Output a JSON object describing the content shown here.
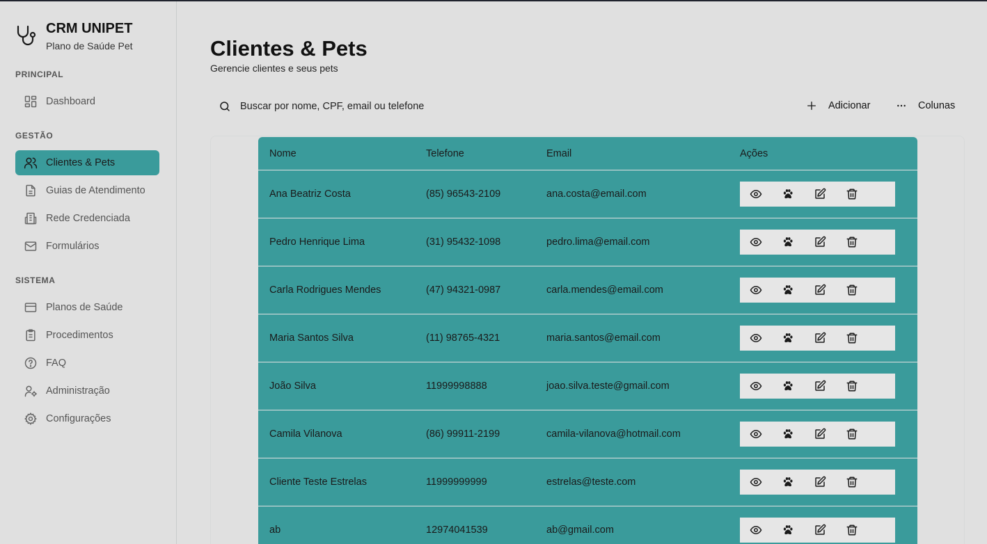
{
  "brand": {
    "title": "CRM UNIPET",
    "subtitle": "Plano de Saúde Pet"
  },
  "sidebar": {
    "sections": [
      {
        "label": "PRINCIPAL",
        "items": [
          {
            "label": "Dashboard",
            "icon": "dashboard-icon"
          }
        ]
      },
      {
        "label": "GESTÃO",
        "items": [
          {
            "label": "Clientes & Pets",
            "icon": "users-icon",
            "active": true
          },
          {
            "label": "Guias de Atendimento",
            "icon": "document-icon"
          },
          {
            "label": "Rede Credenciada",
            "icon": "building-icon"
          },
          {
            "label": "Formulários",
            "icon": "mail-icon"
          }
        ]
      },
      {
        "label": "SISTEMA",
        "items": [
          {
            "label": "Planos de Saúde",
            "icon": "credit-card-icon"
          },
          {
            "label": "Procedimentos",
            "icon": "clipboard-icon"
          },
          {
            "label": "FAQ",
            "icon": "help-circle-icon"
          },
          {
            "label": "Administração",
            "icon": "user-cog-icon"
          },
          {
            "label": "Configurações",
            "icon": "gear-icon"
          }
        ]
      }
    ]
  },
  "header": {
    "title": "Clientes & Pets",
    "subtitle": "Gerencie clientes e seus pets"
  },
  "toolbar": {
    "search_placeholder": "Buscar por nome, CPF, email ou telefone",
    "add_label": "Adicionar",
    "columns_label": "Colunas"
  },
  "table": {
    "columns": [
      "Nome",
      "Telefone",
      "Email",
      "Ações"
    ],
    "rows": [
      {
        "nome": "Ana Beatriz Costa",
        "telefone": "(85) 96543-2109",
        "email": "ana.costa@email.com"
      },
      {
        "nome": "Pedro Henrique Lima",
        "telefone": "(31) 95432-1098",
        "email": "pedro.lima@email.com"
      },
      {
        "nome": "Carla Rodrigues Mendes",
        "telefone": "(47) 94321-0987",
        "email": "carla.mendes@email.com"
      },
      {
        "nome": "Maria Santos Silva",
        "telefone": "(11) 98765-4321",
        "email": "maria.santos@email.com"
      },
      {
        "nome": "João Silva",
        "telefone": "11999998888",
        "email": "joao.silva.teste@gmail.com"
      },
      {
        "nome": "Camila Vilanova",
        "telefone": "(86) 99911-2199",
        "email": "camila-vilanova@hotmail.com"
      },
      {
        "nome": "Cliente Teste Estrelas",
        "telefone": "11999999999",
        "email": "estrelas@teste.com"
      },
      {
        "nome": "ab",
        "telefone": "12974041539",
        "email": "ab@gmail.com"
      }
    ]
  },
  "colors": {
    "accent": "#3a9b9b",
    "background": "#e0e0e0"
  }
}
